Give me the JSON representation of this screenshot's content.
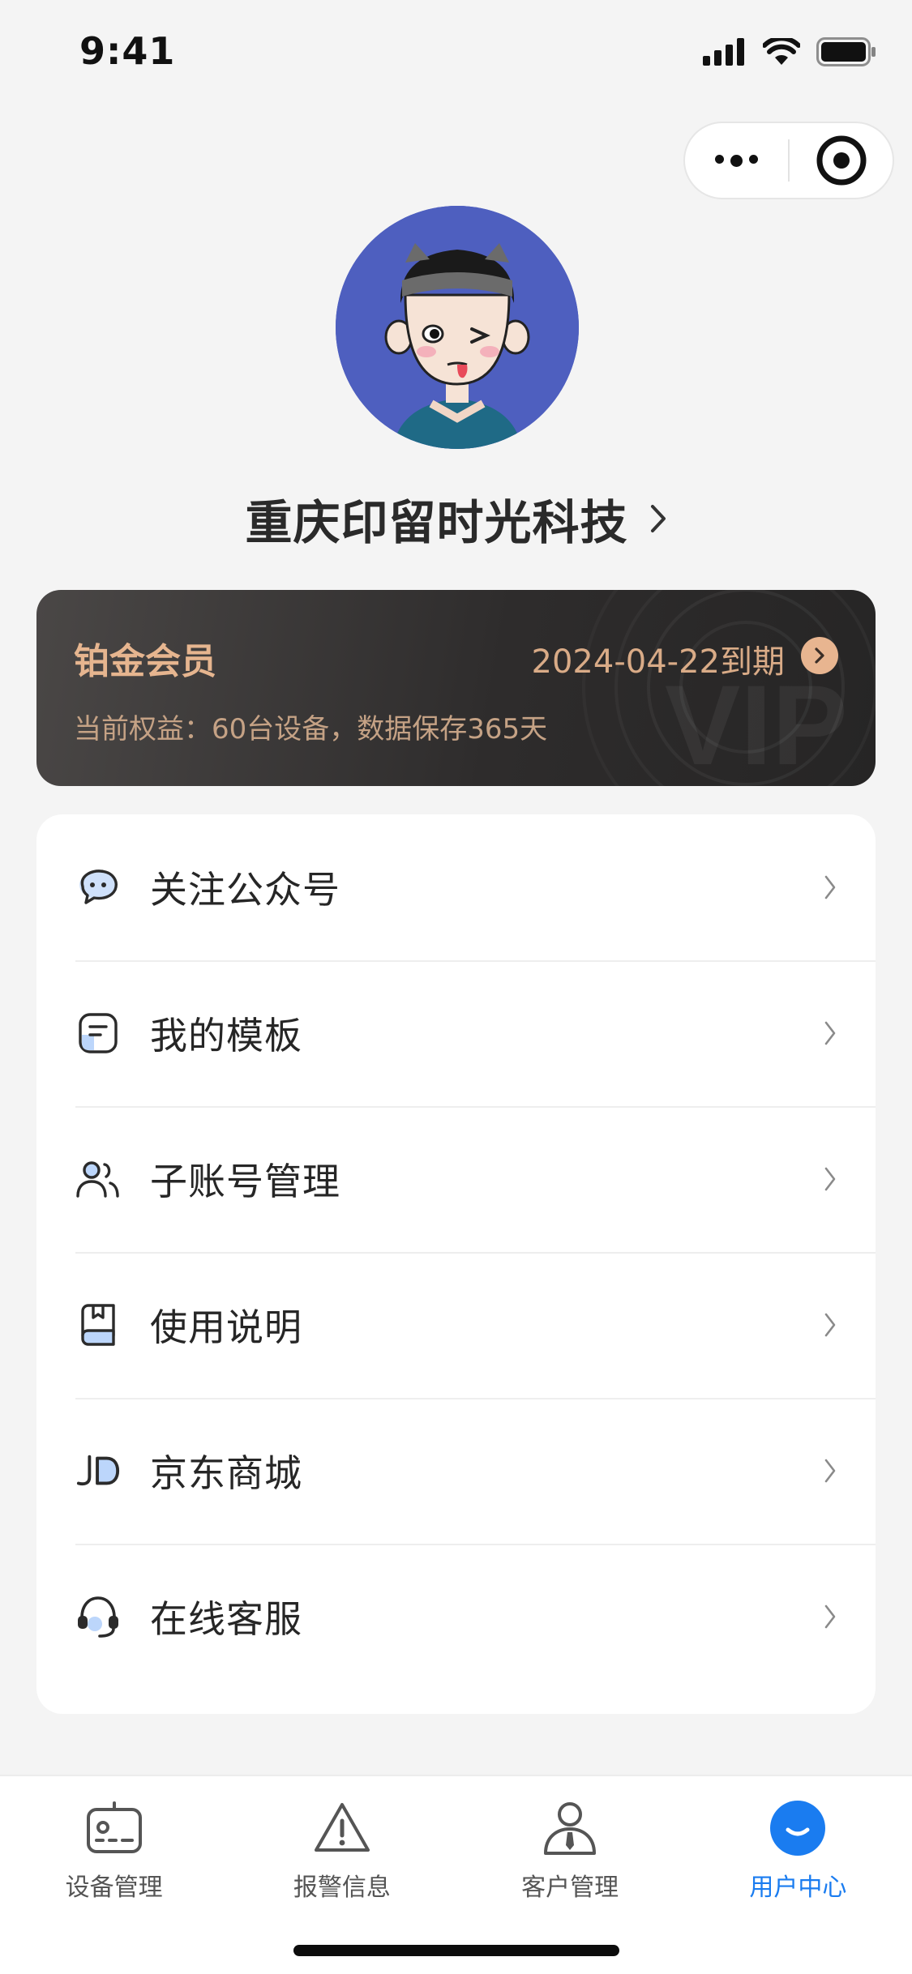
{
  "status_bar": {
    "time": "9:41"
  },
  "profile": {
    "company_name": "重庆印留时光科技"
  },
  "membership": {
    "level": "铂金会员",
    "expiry": "2024-04-22到期",
    "benefit": "当前权益：60台设备，数据保存365天",
    "watermark": "VIP"
  },
  "menu": {
    "items": [
      {
        "label": "关注公众号",
        "icon": "chat-bubble-icon"
      },
      {
        "label": "我的模板",
        "icon": "template-icon"
      },
      {
        "label": "子账号管理",
        "icon": "users-icon"
      },
      {
        "label": "使用说明",
        "icon": "book-icon"
      },
      {
        "label": "京东商城",
        "icon": "jd-logo-icon"
      },
      {
        "label": "在线客服",
        "icon": "headset-icon"
      }
    ]
  },
  "tabbar": {
    "tabs": [
      {
        "label": "设备管理",
        "icon": "device-icon",
        "active": false
      },
      {
        "label": "报警信息",
        "icon": "alert-icon",
        "active": false
      },
      {
        "label": "客户管理",
        "icon": "customer-icon",
        "active": false
      },
      {
        "label": "用户中心",
        "icon": "user-center-icon",
        "active": true
      }
    ]
  },
  "colors": {
    "accent": "#1a7cf0",
    "member_gold": "#e6b58f",
    "card_dark": "#2e2c2c",
    "background": "#f4f4f4"
  }
}
